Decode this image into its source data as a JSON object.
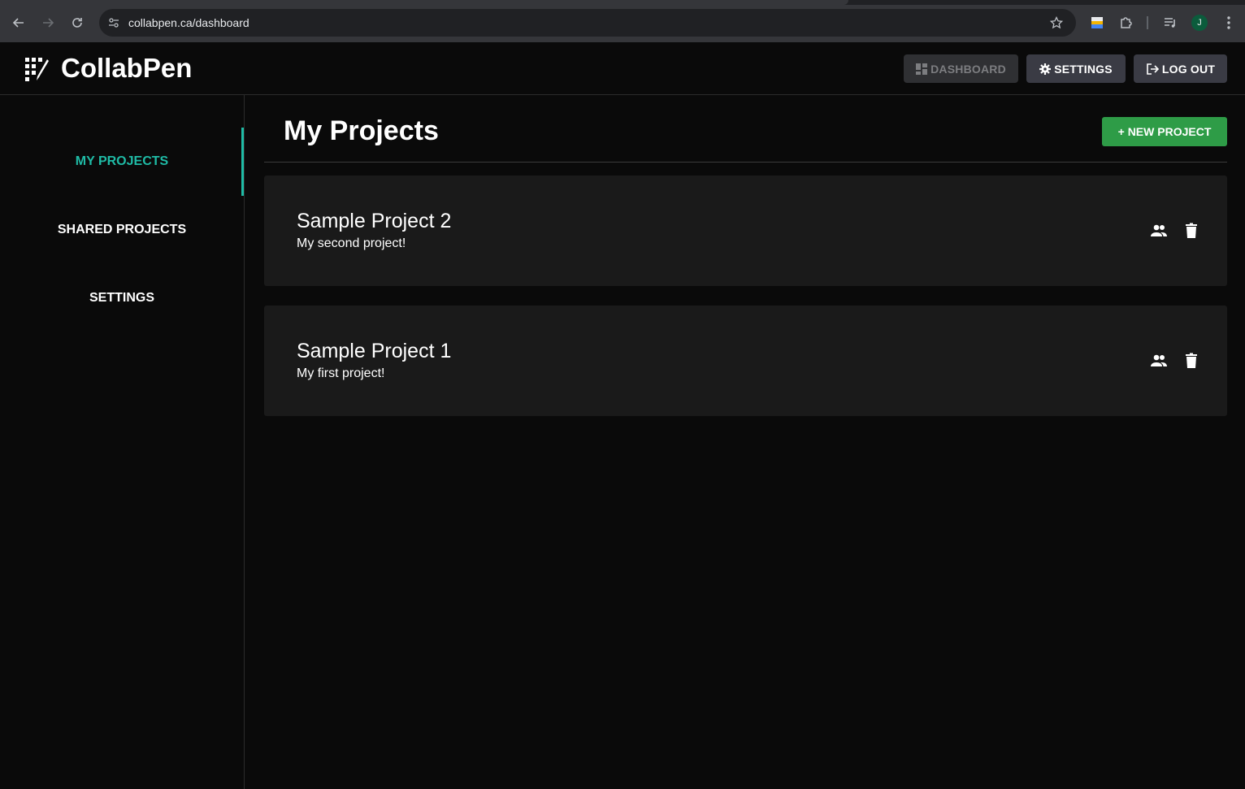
{
  "browser": {
    "url": "collabpen.ca/dashboard",
    "profile_initial": "J"
  },
  "header": {
    "app_name": "CollabPen",
    "buttons": {
      "dashboard": "DASHBOARD",
      "settings": "SETTINGS",
      "logout": "LOG OUT"
    }
  },
  "sidebar": {
    "items": [
      {
        "label": "MY PROJECTS",
        "active": true
      },
      {
        "label": "SHARED PROJECTS",
        "active": false
      },
      {
        "label": "SETTINGS",
        "active": false
      }
    ]
  },
  "main": {
    "title": "My Projects",
    "new_project_label": "+ NEW PROJECT",
    "projects": [
      {
        "name": "Sample Project 2",
        "description": "My second project!"
      },
      {
        "name": "Sample Project 1",
        "description": "My first project!"
      }
    ]
  },
  "colors": {
    "accent": "#1fbba6",
    "primary_button": "#2e9c47",
    "background": "#0a0a0a",
    "card": "#1a1a1a"
  }
}
